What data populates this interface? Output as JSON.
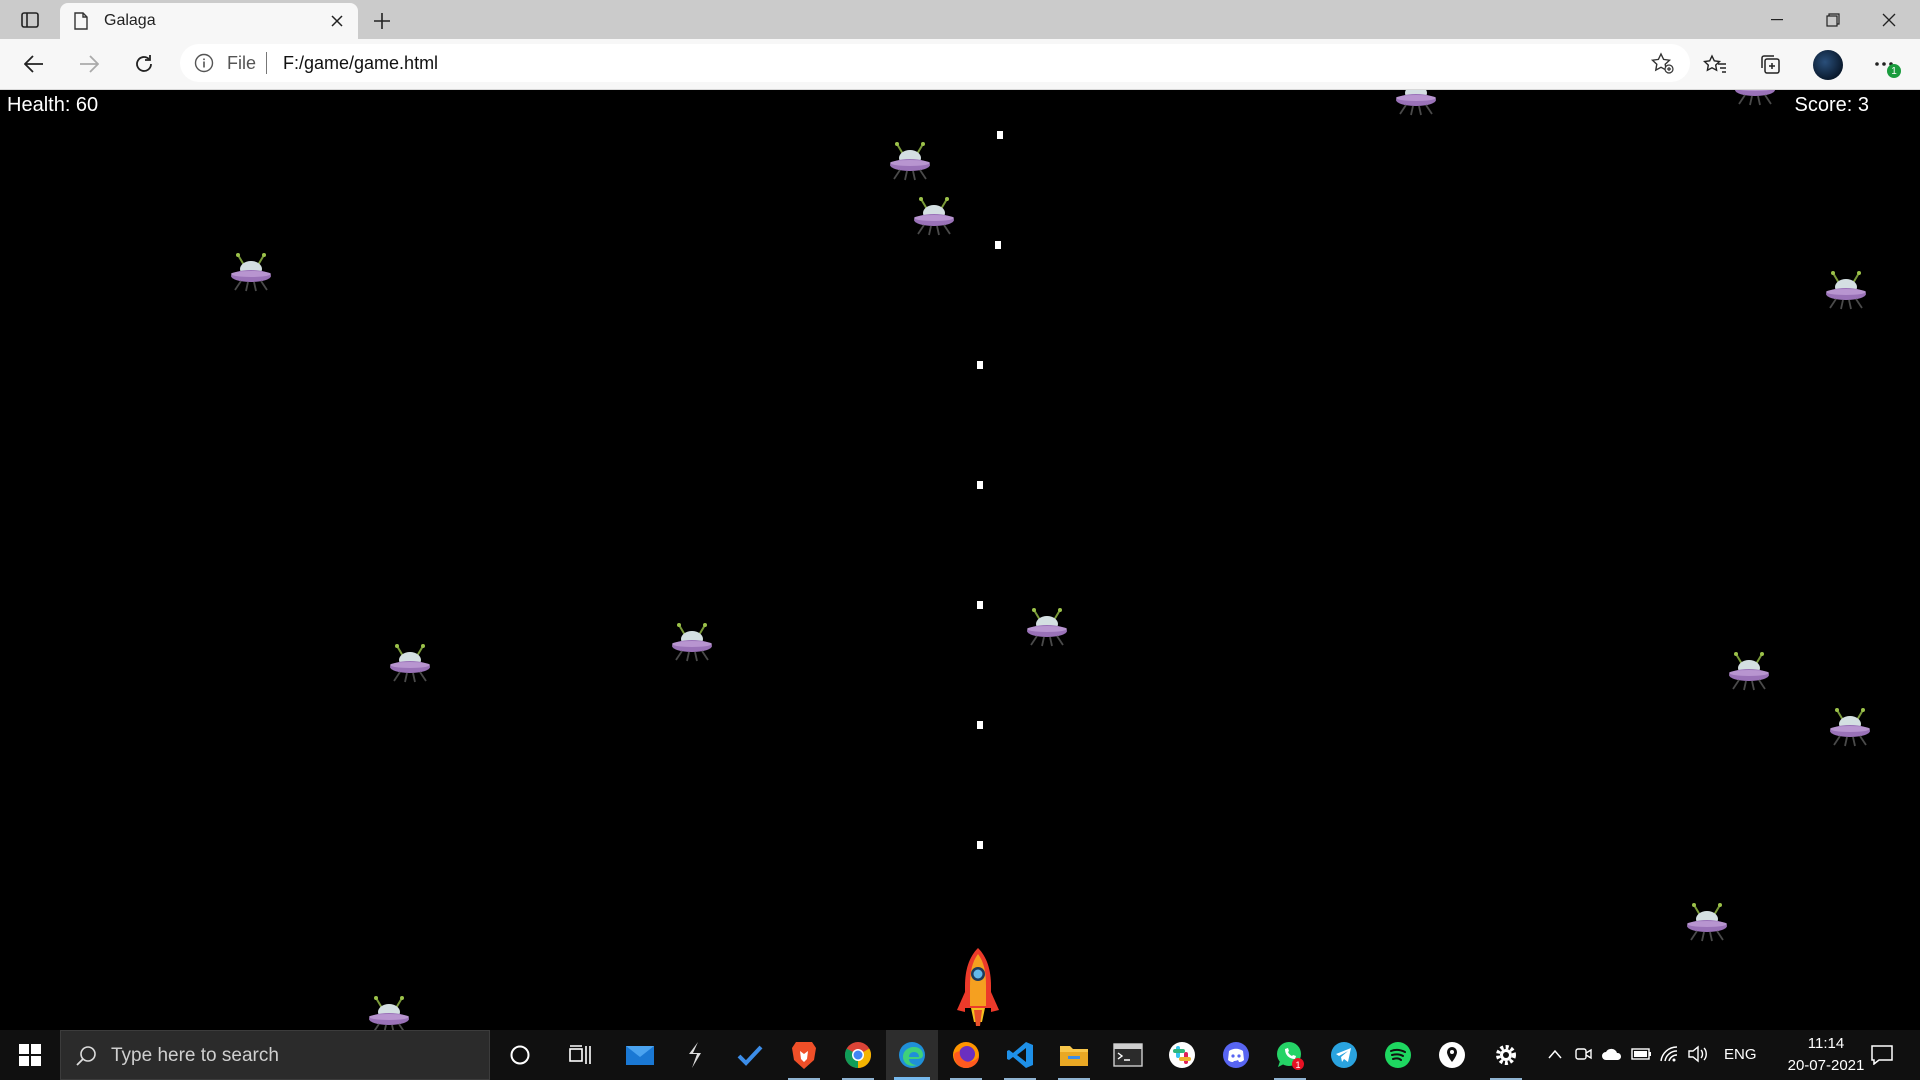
{
  "browser": {
    "tab_title": "Galaga",
    "address_scheme": "File",
    "address_url": "F:/game/game.html"
  },
  "game": {
    "health_text": "Health: 60",
    "score_text": "Score: 3"
  },
  "taskbar": {
    "search_placeholder": "Type here to search",
    "pinned_apps": [
      "task-view",
      "mail",
      "app-s",
      "todo",
      "brave",
      "chrome",
      "edge",
      "firefox",
      "vscode",
      "file-explorer",
      "terminal",
      "slack",
      "discord",
      "whatsapp",
      "telegram",
      "spotify",
      "app-pin",
      "settings"
    ],
    "whatsapp_badge": "1",
    "language": "ENG",
    "time": "11:14",
    "date": "20-07-2021"
  },
  "toolbar": {
    "more_badge": "1"
  }
}
